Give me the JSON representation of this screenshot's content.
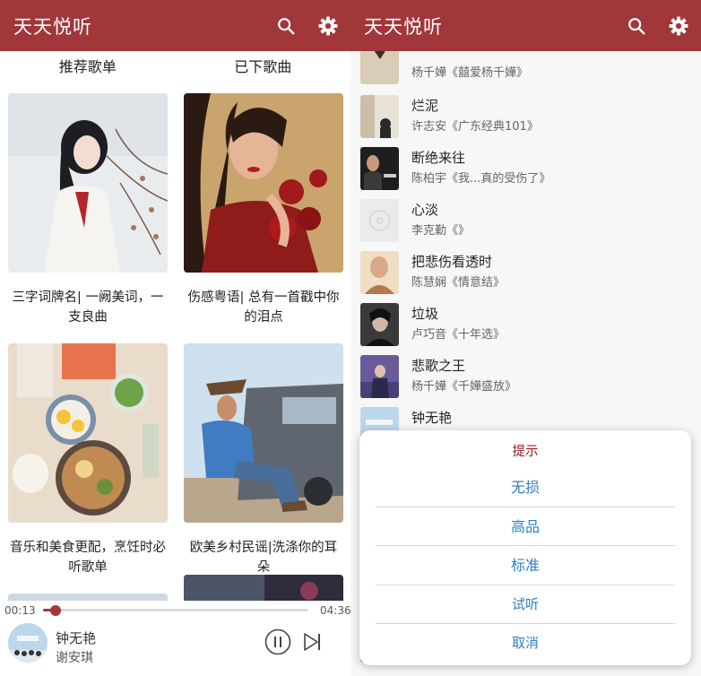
{
  "app": {
    "title": "天天悦听",
    "brand_color": "#a1363b",
    "icons": [
      "search-icon",
      "gear-icon"
    ]
  },
  "left": {
    "tabs": [
      "推荐歌单",
      "已下歌曲"
    ],
    "playlists": [
      {
        "caption": "三字词牌名| 一阙美词，一支良曲"
      },
      {
        "caption": "伤感粤语| 总有一首戳中你的泪点"
      },
      {
        "caption": "音乐和美食更配，烹饪时必听歌单"
      },
      {
        "caption": "欧美乡村民谣|洗涤你的耳朵"
      }
    ],
    "player": {
      "elapsed": "00:13",
      "duration": "04:36",
      "progress": 0.047,
      "title": "钟无艳",
      "artist": "谢安琪",
      "icons": [
        "pause-icon",
        "next-icon"
      ]
    }
  },
  "right": {
    "songs": [
      {
        "title": "",
        "subtitle": "杨千嬅《囍爱杨千嬅》"
      },
      {
        "title": "烂泥",
        "subtitle": "许志安《广东经典101》"
      },
      {
        "title": "断绝来往",
        "subtitle": "陈柏宇《我...真的受伤了》"
      },
      {
        "title": "心淡",
        "subtitle": "李克勤《》"
      },
      {
        "title": "把悲伤看透时",
        "subtitle": "陈慧娴《情意结》"
      },
      {
        "title": "垃圾",
        "subtitle": "卢巧音《十年选》"
      },
      {
        "title": "悲歌之王",
        "subtitle": "杨千嬅《千嬅盛放》"
      },
      {
        "title": "钟无艳",
        "subtitle": ""
      }
    ],
    "dialog": {
      "title": "提示",
      "options": [
        "无损",
        "高品",
        "标准",
        "试听",
        "取消"
      ]
    }
  }
}
